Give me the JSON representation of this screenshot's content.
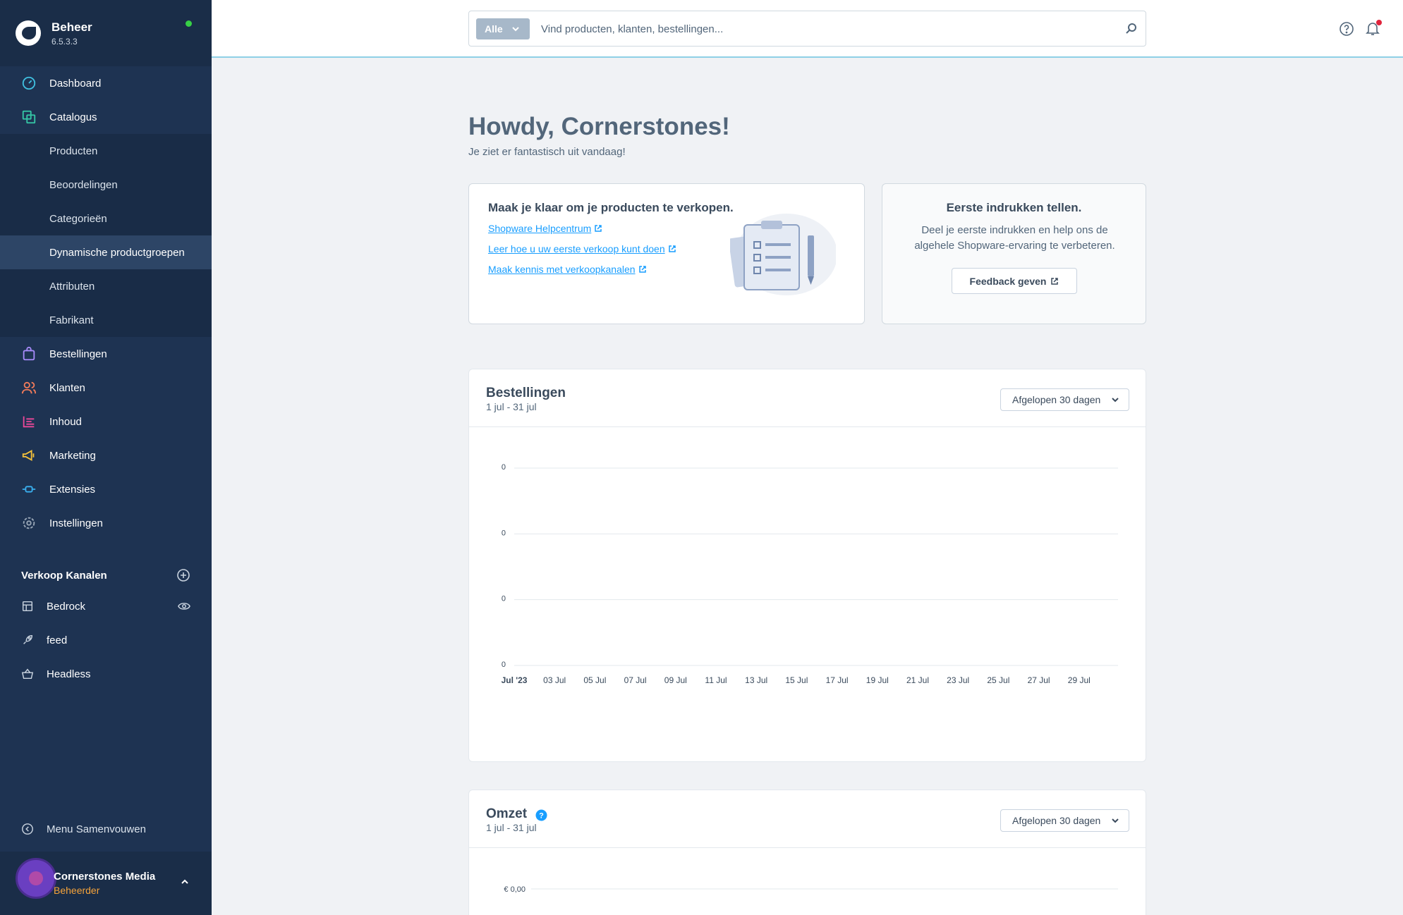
{
  "brand": {
    "title": "Beheer",
    "version": "6.5.3.3"
  },
  "nav": {
    "dashboard": "Dashboard",
    "catalogus": "Catalogus",
    "catalogus_items": [
      "Producten",
      "Beoordelingen",
      "Categorieën",
      "Dynamische productgroepen",
      "Attributen",
      "Fabrikant"
    ],
    "bestellingen": "Bestellingen",
    "klanten": "Klanten",
    "inhoud": "Inhoud",
    "marketing": "Marketing",
    "extensies": "Extensies",
    "instellingen": "Instellingen"
  },
  "sales_channels": {
    "title": "Verkoop Kanalen",
    "items": [
      "Bedrock",
      "feed",
      "Headless"
    ]
  },
  "collapse_label": "Menu Samenvouwen",
  "user": {
    "name": "Cornerstones Media",
    "role": "Beheerder"
  },
  "search": {
    "type": "Alle",
    "placeholder": "Vind producten, klanten, bestellingen..."
  },
  "greeting": {
    "title": "Howdy, Cornerstones!",
    "subtitle": "Je ziet er fantastisch uit vandaag!"
  },
  "setup_card": {
    "title": "Maak je klaar om je producten te verkopen.",
    "links": [
      "Shopware Helpcentrum",
      "Leer hoe u uw eerste verkoop kunt doen",
      "Maak kennis met verkoopkanalen"
    ]
  },
  "feedback_card": {
    "title": "Eerste indrukken tellen.",
    "text": "Deel je eerste indrukken en help ons de algehele Shopware-ervaring te verbeteren.",
    "button": "Feedback geven"
  },
  "orders_chart": {
    "title": "Bestellingen",
    "range": "1 jul - 31 jul",
    "period": "Afgelopen 30 dagen"
  },
  "revenue_chart": {
    "title": "Omzet",
    "range": "1 jul - 31 jul",
    "period": "Afgelopen 30 dagen"
  },
  "colors": {
    "sidebar": "#1e3352",
    "accent": "#189eff",
    "online": "#37d046",
    "role": "#f7a43a"
  },
  "chart_data": [
    {
      "type": "line",
      "title": "Bestellingen",
      "x": [
        "Jul '23",
        "03 Jul",
        "05 Jul",
        "07 Jul",
        "09 Jul",
        "11 Jul",
        "13 Jul",
        "15 Jul",
        "17 Jul",
        "19 Jul",
        "21 Jul",
        "23 Jul",
        "25 Jul",
        "27 Jul",
        "29 Jul"
      ],
      "y_tick_labels": [
        "0",
        "0",
        "0",
        "0"
      ],
      "series": [],
      "grid": true
    },
    {
      "type": "line",
      "title": "Omzet",
      "y_tick_labels": [
        "€ 0,00"
      ],
      "series": [],
      "grid": true
    }
  ]
}
